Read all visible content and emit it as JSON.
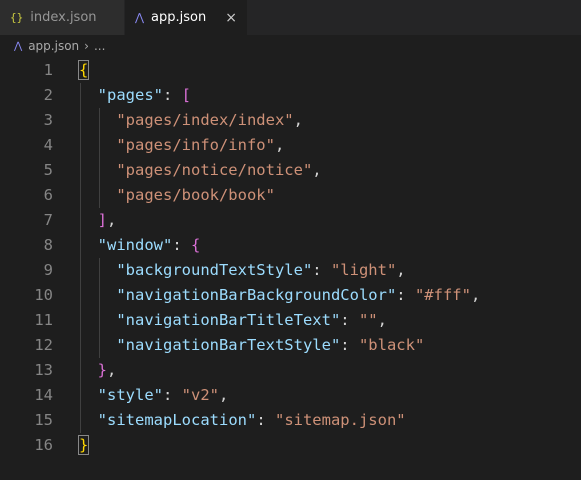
{
  "tabs": [
    {
      "label": "index.json",
      "icon": "json-braces-icon",
      "icon_glyph": "{}",
      "active": false
    },
    {
      "label": "app.json",
      "icon": "miniprogram-icon",
      "icon_glyph": "⋀",
      "active": true,
      "close": "×"
    }
  ],
  "breadcrumb": {
    "file": "app.json",
    "more": "..."
  },
  "colors": {
    "background": "#1e1e1e",
    "key": "#9cdcfe",
    "string": "#ce9178",
    "bracket_level1": "#ffd700",
    "bracket_level2": "#da70d6",
    "bracket_level3": "#179fff",
    "line_number": "#858585"
  },
  "lines": [
    {
      "n": "1",
      "tokens": [
        {
          "t": "{",
          "c": "b1 match"
        }
      ]
    },
    {
      "n": "2",
      "tokens": [
        {
          "t": "  "
        },
        {
          "t": "\"pages\"",
          "c": "key"
        },
        {
          "t": ": "
        },
        {
          "t": "[",
          "c": "b2"
        }
      ]
    },
    {
      "n": "3",
      "tokens": [
        {
          "t": "    "
        },
        {
          "t": "\"pages/index/index\"",
          "c": "str"
        },
        {
          "t": ","
        }
      ]
    },
    {
      "n": "4",
      "tokens": [
        {
          "t": "    "
        },
        {
          "t": "\"pages/info/info\"",
          "c": "str"
        },
        {
          "t": ","
        }
      ]
    },
    {
      "n": "5",
      "tokens": [
        {
          "t": "    "
        },
        {
          "t": "\"pages/notice/notice\"",
          "c": "str"
        },
        {
          "t": ","
        }
      ]
    },
    {
      "n": "6",
      "tokens": [
        {
          "t": "    "
        },
        {
          "t": "\"pages/book/book\"",
          "c": "str"
        }
      ]
    },
    {
      "n": "7",
      "tokens": [
        {
          "t": "  "
        },
        {
          "t": "]",
          "c": "b2"
        },
        {
          "t": ","
        }
      ]
    },
    {
      "n": "8",
      "tokens": [
        {
          "t": "  "
        },
        {
          "t": "\"window\"",
          "c": "key"
        },
        {
          "t": ": "
        },
        {
          "t": "{",
          "c": "b2"
        }
      ]
    },
    {
      "n": "9",
      "tokens": [
        {
          "t": "    "
        },
        {
          "t": "\"backgroundTextStyle\"",
          "c": "key"
        },
        {
          "t": ": "
        },
        {
          "t": "\"light\"",
          "c": "str"
        },
        {
          "t": ","
        }
      ]
    },
    {
      "n": "10",
      "tokens": [
        {
          "t": "    "
        },
        {
          "t": "\"navigationBarBackgroundColor\"",
          "c": "key"
        },
        {
          "t": ": "
        },
        {
          "t": "\"#fff\"",
          "c": "str"
        },
        {
          "t": ","
        }
      ]
    },
    {
      "n": "11",
      "tokens": [
        {
          "t": "    "
        },
        {
          "t": "\"navigationBarTitleText\"",
          "c": "key"
        },
        {
          "t": ": "
        },
        {
          "t": "\"\"",
          "c": "str"
        },
        {
          "t": ","
        }
      ]
    },
    {
      "n": "12",
      "tokens": [
        {
          "t": "    "
        },
        {
          "t": "\"navigationBarTextStyle\"",
          "c": "key"
        },
        {
          "t": ": "
        },
        {
          "t": "\"black\"",
          "c": "str"
        }
      ]
    },
    {
      "n": "13",
      "tokens": [
        {
          "t": "  "
        },
        {
          "t": "}",
          "c": "b2"
        },
        {
          "t": ","
        }
      ]
    },
    {
      "n": "14",
      "tokens": [
        {
          "t": "  "
        },
        {
          "t": "\"style\"",
          "c": "key"
        },
        {
          "t": ": "
        },
        {
          "t": "\"v2\"",
          "c": "str"
        },
        {
          "t": ","
        }
      ]
    },
    {
      "n": "15",
      "tokens": [
        {
          "t": "  "
        },
        {
          "t": "\"sitemapLocation\"",
          "c": "key"
        },
        {
          "t": ": "
        },
        {
          "t": "\"sitemap.json\"",
          "c": "str"
        }
      ]
    },
    {
      "n": "16",
      "tokens": [
        {
          "t": "}",
          "c": "b1 match"
        }
      ]
    }
  ]
}
